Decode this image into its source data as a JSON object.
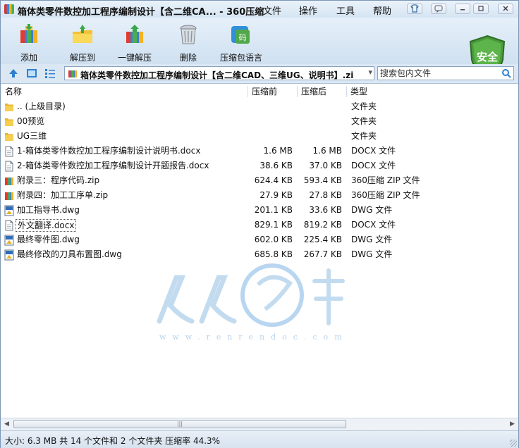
{
  "window": {
    "title": "箱体类零件数控加工程序编制设计【含二维CA... - 360压缩",
    "menu": [
      "文件",
      "操作",
      "工具",
      "帮助"
    ]
  },
  "toolbar": {
    "buttons": [
      {
        "label": "添加",
        "icon": "add-archive-icon"
      },
      {
        "label": "解压到",
        "icon": "extract-to-icon"
      },
      {
        "label": "一键解压",
        "icon": "one-click-extract-icon"
      },
      {
        "label": "删除",
        "icon": "trash-icon"
      },
      {
        "label": "压缩包语言",
        "icon": "archive-language-icon"
      }
    ],
    "security_badge": "安全"
  },
  "address": {
    "path": "箱体类零件数控加工程序编制设计【含二维CAD、三维UG、说明书】.zi",
    "search_placeholder": "搜索包内文件"
  },
  "columns": {
    "name": "名称",
    "compressed": "压缩前",
    "uncompressed": "压缩后",
    "type": "类型"
  },
  "files": [
    {
      "name": ".. (上级目录)",
      "compressed": "",
      "uncompressed": "",
      "type": "文件夹",
      "icon": "folder-icon"
    },
    {
      "name": "00预览",
      "compressed": "",
      "uncompressed": "",
      "type": "文件夹",
      "icon": "folder-icon"
    },
    {
      "name": "UG三维",
      "compressed": "",
      "uncompressed": "",
      "type": "文件夹",
      "icon": "folder-icon"
    },
    {
      "name": "1-箱体类零件数控加工程序编制设计说明书.docx",
      "compressed": "1.6 MB",
      "uncompressed": "1.6 MB",
      "type": "DOCX 文件",
      "icon": "document-icon"
    },
    {
      "name": "2-箱体类零件数控加工程序编制设计开题报告.docx",
      "compressed": "38.6 KB",
      "uncompressed": "37.0 KB",
      "type": "DOCX 文件",
      "icon": "document-icon"
    },
    {
      "name": "附录三：程序代码.zip",
      "compressed": "624.4 KB",
      "uncompressed": "593.4 KB",
      "type": "360压缩 ZIP 文件",
      "icon": "zip-icon"
    },
    {
      "name": "附录四：加工工序单.zip",
      "compressed": "27.9 KB",
      "uncompressed": "27.8 KB",
      "type": "360压缩 ZIP 文件",
      "icon": "zip-icon"
    },
    {
      "name": "加工指导书.dwg",
      "compressed": "201.1 KB",
      "uncompressed": "33.6 KB",
      "type": "DWG 文件",
      "icon": "dwg-icon"
    },
    {
      "name": "外文翻译.docx",
      "compressed": "829.1 KB",
      "uncompressed": "819.2 KB",
      "type": "DOCX 文件",
      "icon": "document-icon"
    },
    {
      "name": "最终零件图.dwg",
      "compressed": "602.0 KB",
      "uncompressed": "225.4 KB",
      "type": "DWG 文件",
      "icon": "dwg-icon"
    },
    {
      "name": "最终修改的刀具布置图.dwg",
      "compressed": "685.8 KB",
      "uncompressed": "267.7 KB",
      "type": "DWG 文件",
      "icon": "dwg-icon"
    }
  ],
  "watermark": {
    "text": "人人文库",
    "url": "www.renrendoc.com"
  },
  "status": {
    "text": "大小: 6.3 MB 共 14 个文件和 2 个文件夹 压缩率 44.3%"
  },
  "colors": {
    "accent": "#2f7fd0",
    "shield": "#4a9a3c",
    "selection_border": "#555555"
  }
}
